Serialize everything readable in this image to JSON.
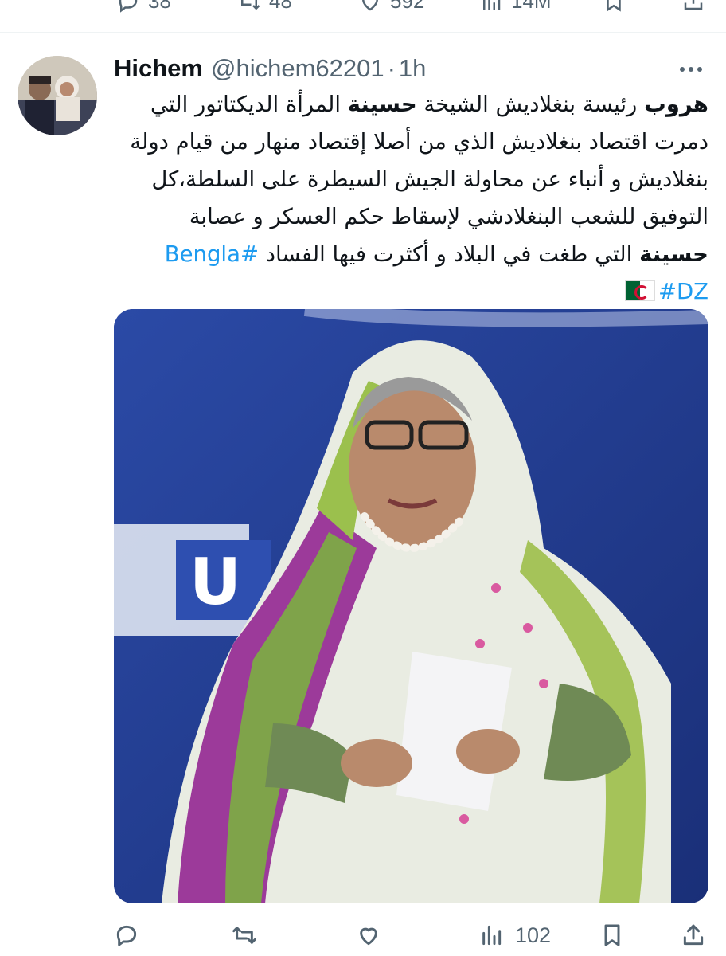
{
  "previous_tweet": {
    "reply_count": "38",
    "retweet_count": "48",
    "like_count": "592",
    "view_count": "14M"
  },
  "tweet": {
    "author_name": "Hichem",
    "handle": "@hichem62201",
    "separator": "·",
    "time": "1h",
    "text_segments": [
      {
        "text": "هروب",
        "style": "bold"
      },
      {
        "text": " رئيسة بنغلاديش الشيخة ",
        "style": "normal"
      },
      {
        "text": "حسينة",
        "style": "bold"
      },
      {
        "text": " المرأة الديكتاتور التي دمرت اقتصاد بنغلاديش الذي من أصلا إقتصاد منهار من قيام دولة بنغلاديش و أنباء عن محاولة الجيش السيطرة على السلطة،كل التوفيق للشعب البنغلادشي لإسقاط حكم العسكر و عصابة ",
        "style": "normal"
      },
      {
        "text": "حسينة",
        "style": "bold"
      },
      {
        "text": " التي طغت في البلاد و أكثرت فيها الفساد ",
        "style": "normal"
      },
      {
        "text": "#Bengla",
        "style": "hashtag"
      },
      {
        "text": " ",
        "style": "normal"
      },
      {
        "text": "#DZ",
        "style": "hashtag"
      }
    ],
    "flag_emoji": "algeria-flag",
    "image_alt": "photo-woman-in-sari-holding-paper",
    "reply_count": "",
    "retweet_count": "",
    "like_count": "",
    "view_count": "102"
  },
  "colors": {
    "accent": "#1d9bf0",
    "secondary_text": "#536471",
    "primary_text": "#0f1419"
  }
}
